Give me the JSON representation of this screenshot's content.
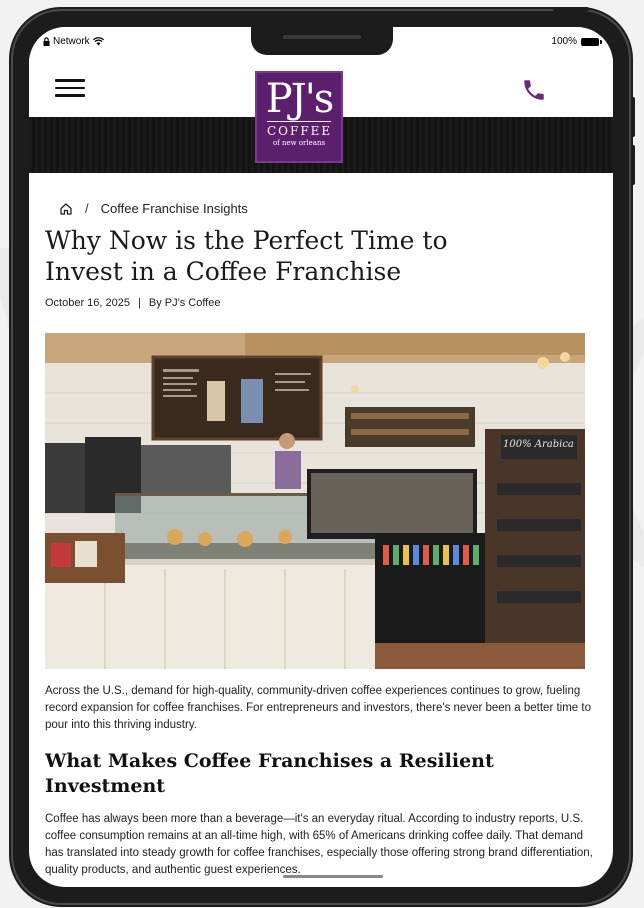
{
  "status_bar": {
    "network": "Network",
    "battery": "100%"
  },
  "header": {
    "logo_main": "PJ's",
    "logo_sub": "COFFEE",
    "logo_tag": "of new orleans",
    "logo_color": "#5b1f6e",
    "menu_icon": "hamburger-menu-icon",
    "phone_icon": "phone-icon",
    "phone_color": "#6a2a82"
  },
  "breadcrumb": {
    "home_icon": "home-icon",
    "separator": "/",
    "current": "Coffee Franchise Insights"
  },
  "article": {
    "title": "Why Now is the Perfect Time to Invest in a Coffee Franchise",
    "date": "October 16, 2025",
    "divider": "|",
    "author": "By PJ's Coffee",
    "hero_sign": "100% Arabica",
    "intro": "Across the U.S., demand for high-quality, community-driven coffee experiences continues to grow, fueling record expansion for coffee franchises. For entrepreneurs and investors, there's never been a better time to pour into this thriving industry.",
    "section_heading": "What Makes Coffee Franchises a Resilient Investment",
    "body": "Coffee has always been more than a beverage—it's an everyday ritual. According to industry reports, U.S. coffee consumption remains at an all-time high, with 65% of Americans drinking coffee daily. That demand has translated into steady growth for coffee franchises, especially those offering strong brand differentiation, quality products, and authentic guest experiences."
  }
}
